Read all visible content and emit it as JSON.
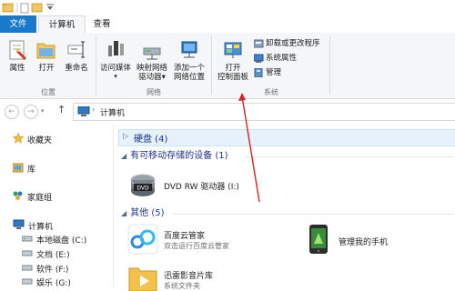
{
  "ribbon_tabs": {
    "file": "文件",
    "computer": "计算机",
    "view": "查看"
  },
  "ribbon": {
    "properties": "属性",
    "open": "打开",
    "rename": "重命名",
    "access_media": "访问媒体",
    "map_drive_line1": "映射网络",
    "map_drive_line2": "驱动器",
    "add_location_line1": "添加一个",
    "add_location_line2": "网络位置",
    "open_cp_line1": "打开",
    "open_cp_line2": "控制面板",
    "uninstall": "卸载或更改程序",
    "system_props": "系统属性",
    "manage": "管理",
    "group_location": "位置",
    "group_network": "网络",
    "group_system": "系统"
  },
  "address": {
    "path": "计算机"
  },
  "nav": {
    "favorites": "收藏夹",
    "library": "库",
    "homegroup": "家庭组",
    "computer": "计算机",
    "drives": [
      "本地磁盘 (C:)",
      "文档 (E:)",
      "软件 (F:)",
      "娱乐 (G:)"
    ]
  },
  "content": {
    "hdd_header": "硬盘 (4)",
    "removable_header": "有可移动存储的设备 (1)",
    "dvd_label": "DVD RW 驱动器 (I:)",
    "dvd_badge": "DVD",
    "other_header": "其他 (5)",
    "items": [
      {
        "title": "百度云管家",
        "subtitle": "双击运行百度云管家"
      },
      {
        "title": "管理我的手机",
        "subtitle": ""
      },
      {
        "title": "迅雷影音片库",
        "subtitle": "系统文件夹"
      }
    ]
  },
  "colors": {
    "accent": "#1979ca",
    "header_text": "#1e3287",
    "annotation_arrow": "#d92121"
  }
}
